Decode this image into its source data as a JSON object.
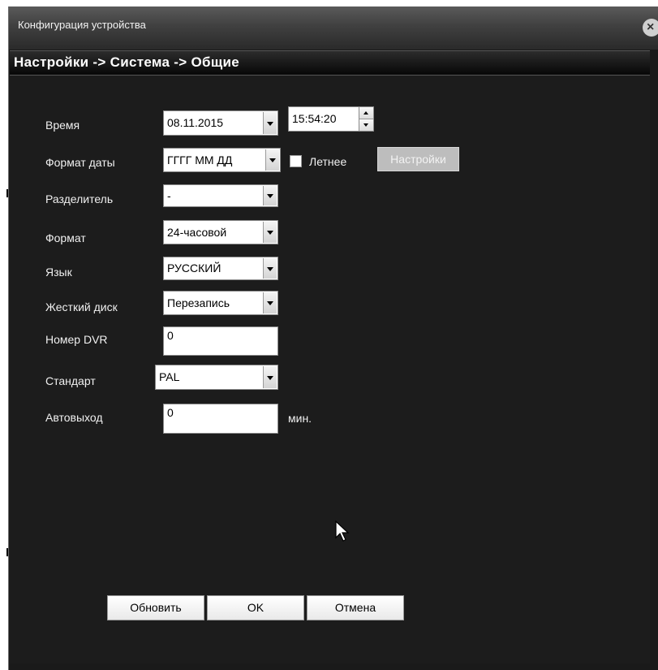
{
  "window": {
    "title": "Конфигурация устройства",
    "close_icon": "close-icon"
  },
  "breadcrumb": "Настройки -> Система -> Общие",
  "form": {
    "time": {
      "label": "Время",
      "date": "08.11.2015",
      "time": "15:54:20"
    },
    "date_format": {
      "label": "Формат даты",
      "value": "ГГГГ ММ ДД",
      "dst_label": "Летнее",
      "dst_checked": false,
      "settings_button": "Настройки"
    },
    "separator": {
      "label": "Разделитель",
      "value": "-"
    },
    "time_format": {
      "label": "Формат",
      "value": "24-часовой"
    },
    "language": {
      "label": "Язык",
      "value": "РУССКИЙ"
    },
    "hdd": {
      "label": "Жесткий диск",
      "value": "Перезапись"
    },
    "dvr_number": {
      "label": "Номер DVR",
      "value": "0"
    },
    "standard": {
      "label": "Стандарт",
      "value": "PAL"
    },
    "auto_logout": {
      "label": "Автовыход",
      "value": "0",
      "unit": "мин."
    }
  },
  "buttons": {
    "refresh": "Обновить",
    "ok": "OK",
    "cancel": "Отмена"
  },
  "colors": {
    "window_bg": "#1c1c1c",
    "titlebar": "#404040",
    "disabled_button": "#bdbdbd"
  }
}
